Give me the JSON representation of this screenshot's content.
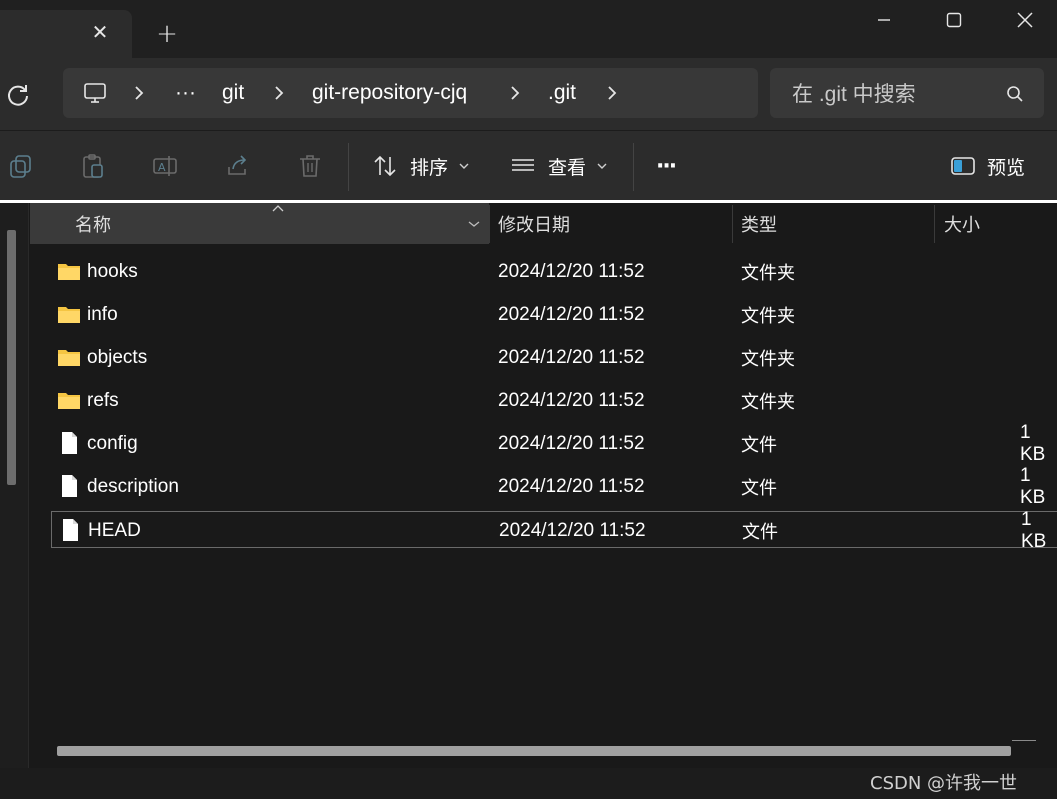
{
  "window": {
    "tab_close_glyph": "✕",
    "new_tab_glyph": "+",
    "minimize_glyph": "—",
    "close_glyph": "✕"
  },
  "address": {
    "overflow": "···",
    "crumbs": [
      "git",
      "git-repository-cjq",
      ".git"
    ]
  },
  "search": {
    "placeholder": "在 .git 中搜索"
  },
  "toolbar": {
    "sort_label": "排序",
    "view_label": "查看",
    "more_label": "···",
    "preview_label": "预览"
  },
  "columns": {
    "name": "名称",
    "modified": "修改日期",
    "type": "类型",
    "size": "大小"
  },
  "files": [
    {
      "name": "hooks",
      "modified": "2024/12/20 11:52",
      "type": "文件夹",
      "size": "",
      "kind": "folder"
    },
    {
      "name": "info",
      "modified": "2024/12/20 11:52",
      "type": "文件夹",
      "size": "",
      "kind": "folder"
    },
    {
      "name": "objects",
      "modified": "2024/12/20 11:52",
      "type": "文件夹",
      "size": "",
      "kind": "folder"
    },
    {
      "name": "refs",
      "modified": "2024/12/20 11:52",
      "type": "文件夹",
      "size": "",
      "kind": "folder"
    },
    {
      "name": "config",
      "modified": "2024/12/20 11:52",
      "type": "文件",
      "size": "1 KB",
      "kind": "file"
    },
    {
      "name": "description",
      "modified": "2024/12/20 11:52",
      "type": "文件",
      "size": "1 KB",
      "kind": "file"
    },
    {
      "name": "HEAD",
      "modified": "2024/12/20 11:52",
      "type": "文件",
      "size": "1 KB",
      "kind": "file"
    }
  ],
  "watermark": "CSDN @许我一世",
  "colors": {
    "folder": "#f5c542",
    "background": "#191919"
  }
}
